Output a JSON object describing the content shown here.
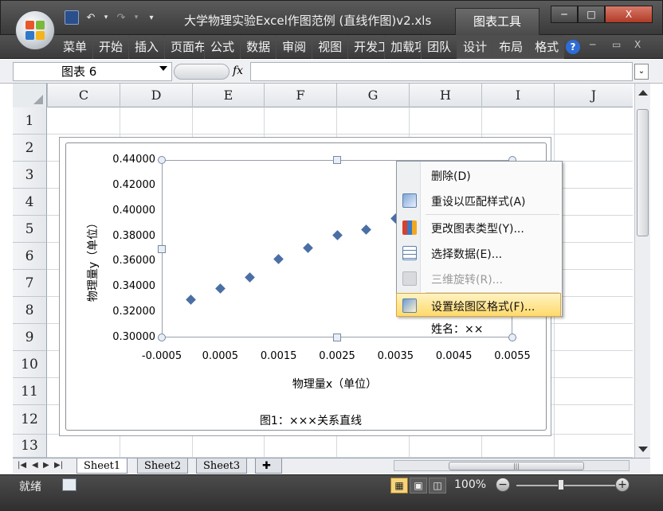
{
  "window": {
    "title": "大学物理实验Excel作图范例 (直线作图)v2.xls",
    "context_tab": "图表工具",
    "minimize": "─",
    "maximize": "□",
    "close": "X"
  },
  "quick_access": {
    "save_icon": "save-icon",
    "undo_icon": "undo-icon",
    "redo_icon": "redo-icon"
  },
  "ribbon": {
    "tabs": [
      "菜单",
      "开始",
      "插入",
      "页面布",
      "公式",
      "数据",
      "审阅",
      "视图",
      "开发工",
      "加载项",
      "团队",
      "设计",
      "布局",
      "格式"
    ],
    "help": "?",
    "mini_min": "─",
    "mini_restore": "▭",
    "mini_close": "X"
  },
  "formula_bar": {
    "name_box": "图表 6",
    "fx": "fx",
    "formula": ""
  },
  "grid": {
    "columns": [
      "C",
      "D",
      "E",
      "F",
      "G",
      "H",
      "I",
      "J"
    ],
    "rows": [
      "1",
      "2",
      "3",
      "4",
      "5",
      "6",
      "7",
      "8",
      "9",
      "10",
      "11",
      "12",
      "13"
    ]
  },
  "chart_data": {
    "type": "scatter",
    "title": "图1：×××关系直线",
    "xlabel": "物理量x（单位）",
    "ylabel": "物理量y（单位）",
    "xlim": [
      -0.0005,
      0.0055
    ],
    "ylim": [
      0.3,
      0.44
    ],
    "x_ticks": [
      "-0.0005",
      "0.0005",
      "0.0015",
      "0.0025",
      "0.0035",
      "0.0045",
      "0.0055"
    ],
    "y_ticks": [
      "0.44000",
      "0.42000",
      "0.40000",
      "0.38000",
      "0.36000",
      "0.34000",
      "0.32000",
      "0.30000"
    ],
    "x": [
      0.0,
      0.0005,
      0.001,
      0.0015,
      0.002,
      0.0025,
      0.003,
      0.0035
    ],
    "y": [
      0.3298,
      0.3386,
      0.3474,
      0.362,
      0.3708,
      0.3808,
      0.385,
      0.394
    ],
    "marker_color": "#4a6fa5",
    "grid": false,
    "annotation": "姓名：××"
  },
  "context_menu": {
    "items": [
      {
        "label": "删除(D)",
        "icon": "",
        "enabled": true
      },
      {
        "label": "重设以匹配样式(A)",
        "icon": "reset-style-icon",
        "enabled": true
      },
      {
        "label": "更改图表类型(Y)...",
        "icon": "chart-type-icon",
        "enabled": true
      },
      {
        "label": "选择数据(E)...",
        "icon": "select-data-icon",
        "enabled": true
      },
      {
        "label": "三维旋转(R)...",
        "icon": "rotate-3d-icon",
        "enabled": false
      },
      {
        "label": "设置绘图区格式(F)...",
        "icon": "format-plot-icon",
        "enabled": true,
        "highlighted": true
      }
    ]
  },
  "sheets": {
    "tabs": [
      "Sheet1",
      "Sheet2",
      "Sheet3"
    ],
    "active": "Sheet1"
  },
  "status": {
    "ready": "就绪",
    "zoom": "100%",
    "zoom_out": "−",
    "zoom_in": "+"
  }
}
